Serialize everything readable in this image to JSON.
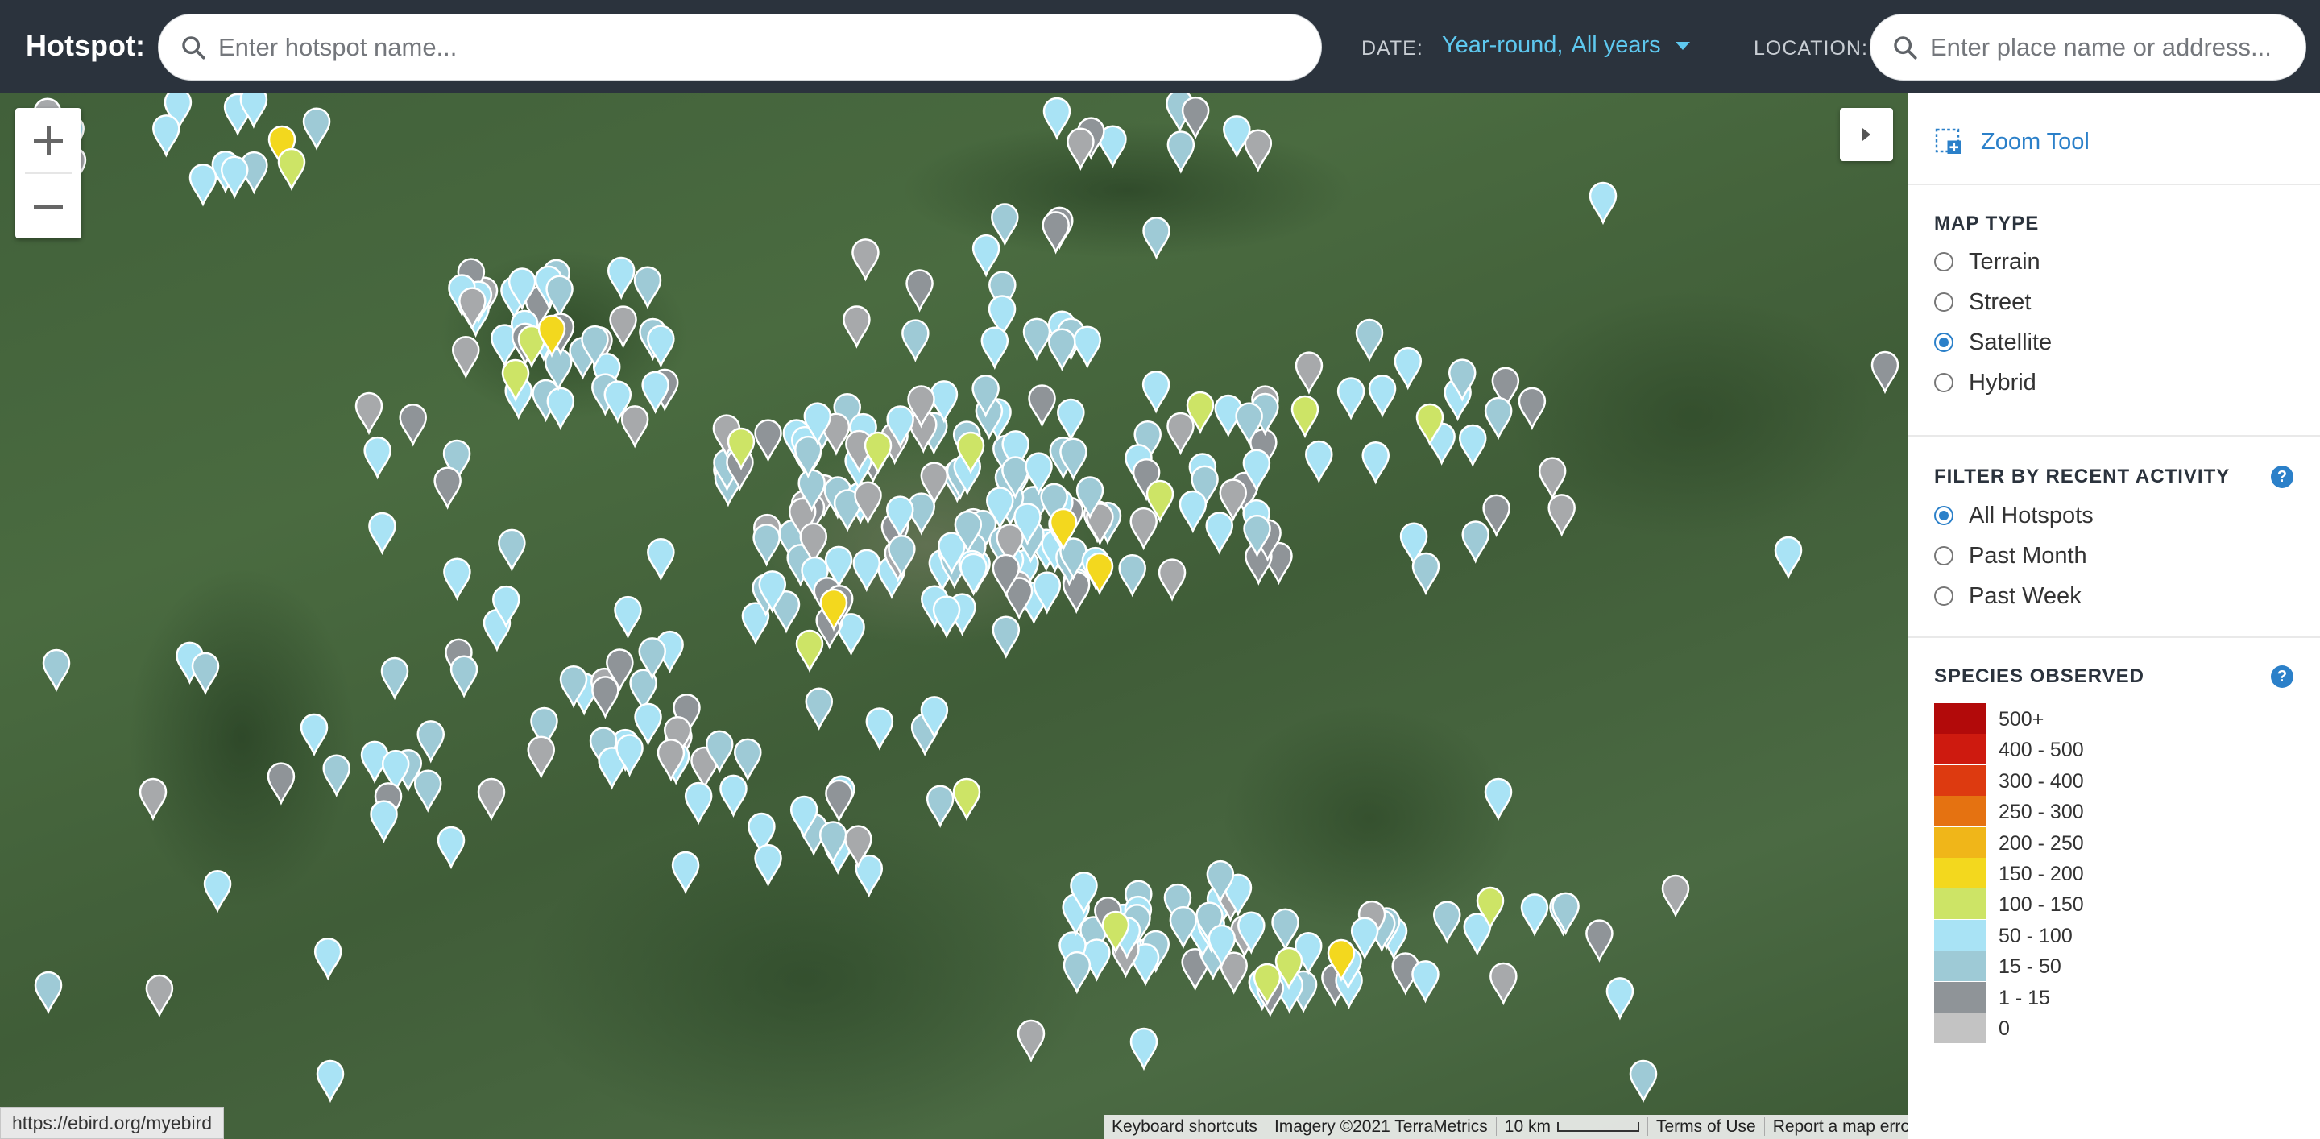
{
  "header": {
    "brand_label": "Hotspot:",
    "hotspot_search": {
      "placeholder": "Enter hotspot name...",
      "value": "",
      "icon": "search-icon"
    },
    "date_label": "DATE:",
    "date_season": "Year-round,",
    "date_years": "All years",
    "location_label": "LOCATION:",
    "location_search": {
      "placeholder": "Enter place name or address...",
      "value": "",
      "icon": "search-icon"
    }
  },
  "map": {
    "status_url": "https://ebird.org/myebird",
    "attribution": {
      "shortcuts": "Keyboard shortcuts",
      "imagery": "Imagery ©2021 TerraMetrics",
      "scale": "10 km",
      "terms": "Terms of Use",
      "report": "Report a map error"
    },
    "marker_colors": {
      "0": "#a7a9ab",
      "1-15": "#8f9498",
      "15-50": "#9ecad6",
      "50-100": "#a9e3f5",
      "100-150": "#cde466",
      "150-200": "#f3d81e"
    }
  },
  "sidepanel": {
    "zoom_tool_label": "Zoom Tool",
    "map_type": {
      "title": "MAP TYPE",
      "options": [
        "Terrain",
        "Street",
        "Satellite",
        "Hybrid"
      ],
      "selected": "Satellite"
    },
    "recent_activity": {
      "title": "FILTER BY RECENT ACTIVITY",
      "options": [
        "All Hotspots",
        "Past Month",
        "Past Week"
      ],
      "selected": "All Hotspots"
    },
    "species_observed": {
      "title": "SPECIES OBSERVED",
      "legend": [
        {
          "label": "500+",
          "color": "#b20a0a"
        },
        {
          "label": "400 - 500",
          "color": "#ce1a0f"
        },
        {
          "label": "300 - 400",
          "color": "#dd3a10"
        },
        {
          "label": "250 - 300",
          "color": "#e57211"
        },
        {
          "label": "200 - 250",
          "color": "#f0b619"
        },
        {
          "label": "150 - 200",
          "color": "#f3d81e"
        },
        {
          "label": "100 - 150",
          "color": "#cde466"
        },
        {
          "label": "50 - 100",
          "color": "#a9e3f5"
        },
        {
          "label": "15 - 50",
          "color": "#9ecad6"
        },
        {
          "label": "1 - 15",
          "color": "#8f9498"
        },
        {
          "label": "0",
          "color": "#c3c3c3"
        }
      ]
    }
  }
}
